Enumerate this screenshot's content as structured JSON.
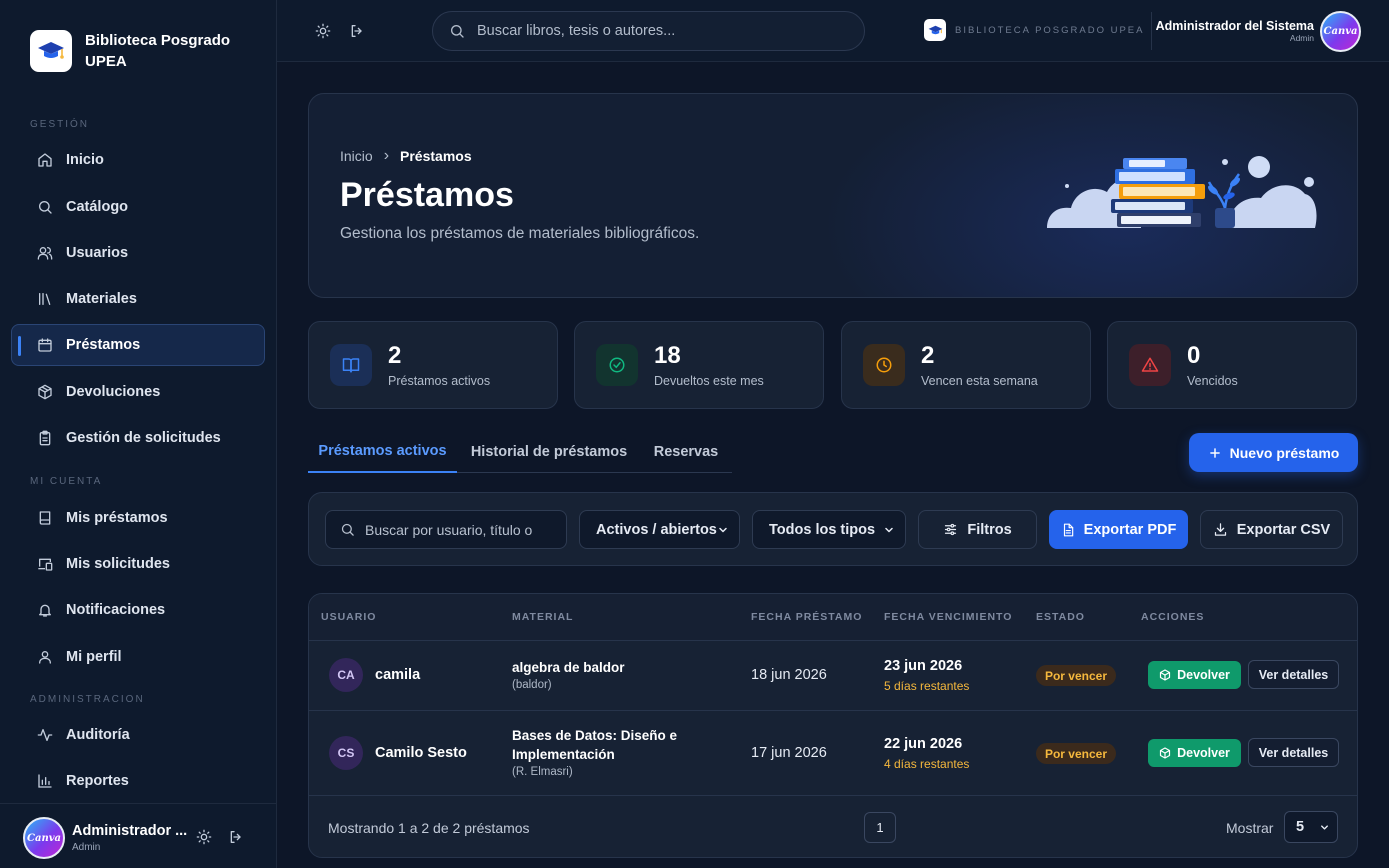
{
  "sidebar": {
    "brand": "Biblioteca Posgrado UPEA",
    "sections": {
      "gestion": "GESTIÓN",
      "mi_cuenta": "MI CUENTA",
      "administracion": "ADMINISTRACION"
    },
    "items": [
      {
        "label": "Inicio",
        "icon": "home-icon"
      },
      {
        "label": "Catálogo",
        "icon": "search-icon"
      },
      {
        "label": "Usuarios",
        "icon": "users-icon"
      },
      {
        "label": "Materiales",
        "icon": "library-icon"
      },
      {
        "label": "Préstamos",
        "icon": "calendar-icon",
        "active": true
      },
      {
        "label": "Devoluciones",
        "icon": "package-icon"
      },
      {
        "label": "Gestión de solicitudes",
        "icon": "clipboard-icon"
      },
      {
        "label": "Mis préstamos",
        "icon": "book-icon"
      },
      {
        "label": "Mis solicitudes",
        "icon": "devices-icon"
      },
      {
        "label": "Notificaciones",
        "icon": "bell-icon"
      },
      {
        "label": "Mi perfil",
        "icon": "user-icon"
      },
      {
        "label": "Auditoría",
        "icon": "activity-icon"
      },
      {
        "label": "Reportes",
        "icon": "bar-chart-icon"
      }
    ],
    "footer": {
      "avatar_text": "Canva",
      "name": "Administrador ...",
      "role": "Admin"
    }
  },
  "topbar": {
    "search_placeholder": "Buscar libros, tesis o autores...",
    "brand_small": "BIBLIOTECA POSGRADO UPEA",
    "user_name": "Administrador del Sistema",
    "user_role": "Admin",
    "avatar_text": "Canva"
  },
  "hero": {
    "breadcrumb_home": "Inicio",
    "breadcrumb_sep": "›",
    "breadcrumb_current": "Préstamos",
    "title": "Préstamos",
    "subtitle": "Gestiona los préstamos de materiales bibliográficos."
  },
  "stats": [
    {
      "value": "2",
      "label": "Préstamos activos",
      "color": "#3b82f6",
      "icon": "book-open-icon"
    },
    {
      "value": "18",
      "label": "Devueltos este mes",
      "color": "#10b981",
      "icon": "check-circle-icon"
    },
    {
      "value": "2",
      "label": "Vencen esta semana",
      "color": "#f59e0b",
      "icon": "clock-icon"
    },
    {
      "value": "0",
      "label": "Vencidos",
      "color": "#ef4444",
      "icon": "alert-triangle-icon"
    }
  ],
  "tabs": [
    "Préstamos activos",
    "Historial de préstamos",
    "Reservas"
  ],
  "new_button": "Nuevo préstamo",
  "filters": {
    "search_placeholder": "Buscar por usuario, título o",
    "status_select": "Activos / abiertos",
    "type_select": "Todos los tipos",
    "filters_button": "Filtros",
    "export_pdf": "Exportar PDF",
    "export_csv": "Exportar CSV"
  },
  "table": {
    "headers": [
      "USUARIO",
      "MATERIAL",
      "FECHA PRÉSTAMO",
      "FECHA VENCIMIENTO",
      "ESTADO",
      "ACCIONES"
    ],
    "rows": [
      {
        "initials": "CA",
        "user": "camila",
        "title": "algebra de baldor",
        "author": "(baldor)",
        "loan_date": "18 jun 2026",
        "due_date": "23 jun 2026",
        "days_left": "5 días restantes",
        "status": "Por vencer",
        "return_label": "Devolver",
        "details_label": "Ver detalles"
      },
      {
        "initials": "CS",
        "user": "Camilo Sesto",
        "title": "Bases de Datos: Diseño e Implementación",
        "author": "(R. Elmasri)",
        "loan_date": "17 jun 2026",
        "due_date": "22 jun 2026",
        "days_left": "4 días restantes",
        "status": "Por vencer",
        "return_label": "Devolver",
        "details_label": "Ver detalles"
      }
    ],
    "footer_text": "Mostrando 1 a 2 de 2 préstamos",
    "page": "1",
    "show_label": "Mostrar",
    "page_size": "5"
  }
}
